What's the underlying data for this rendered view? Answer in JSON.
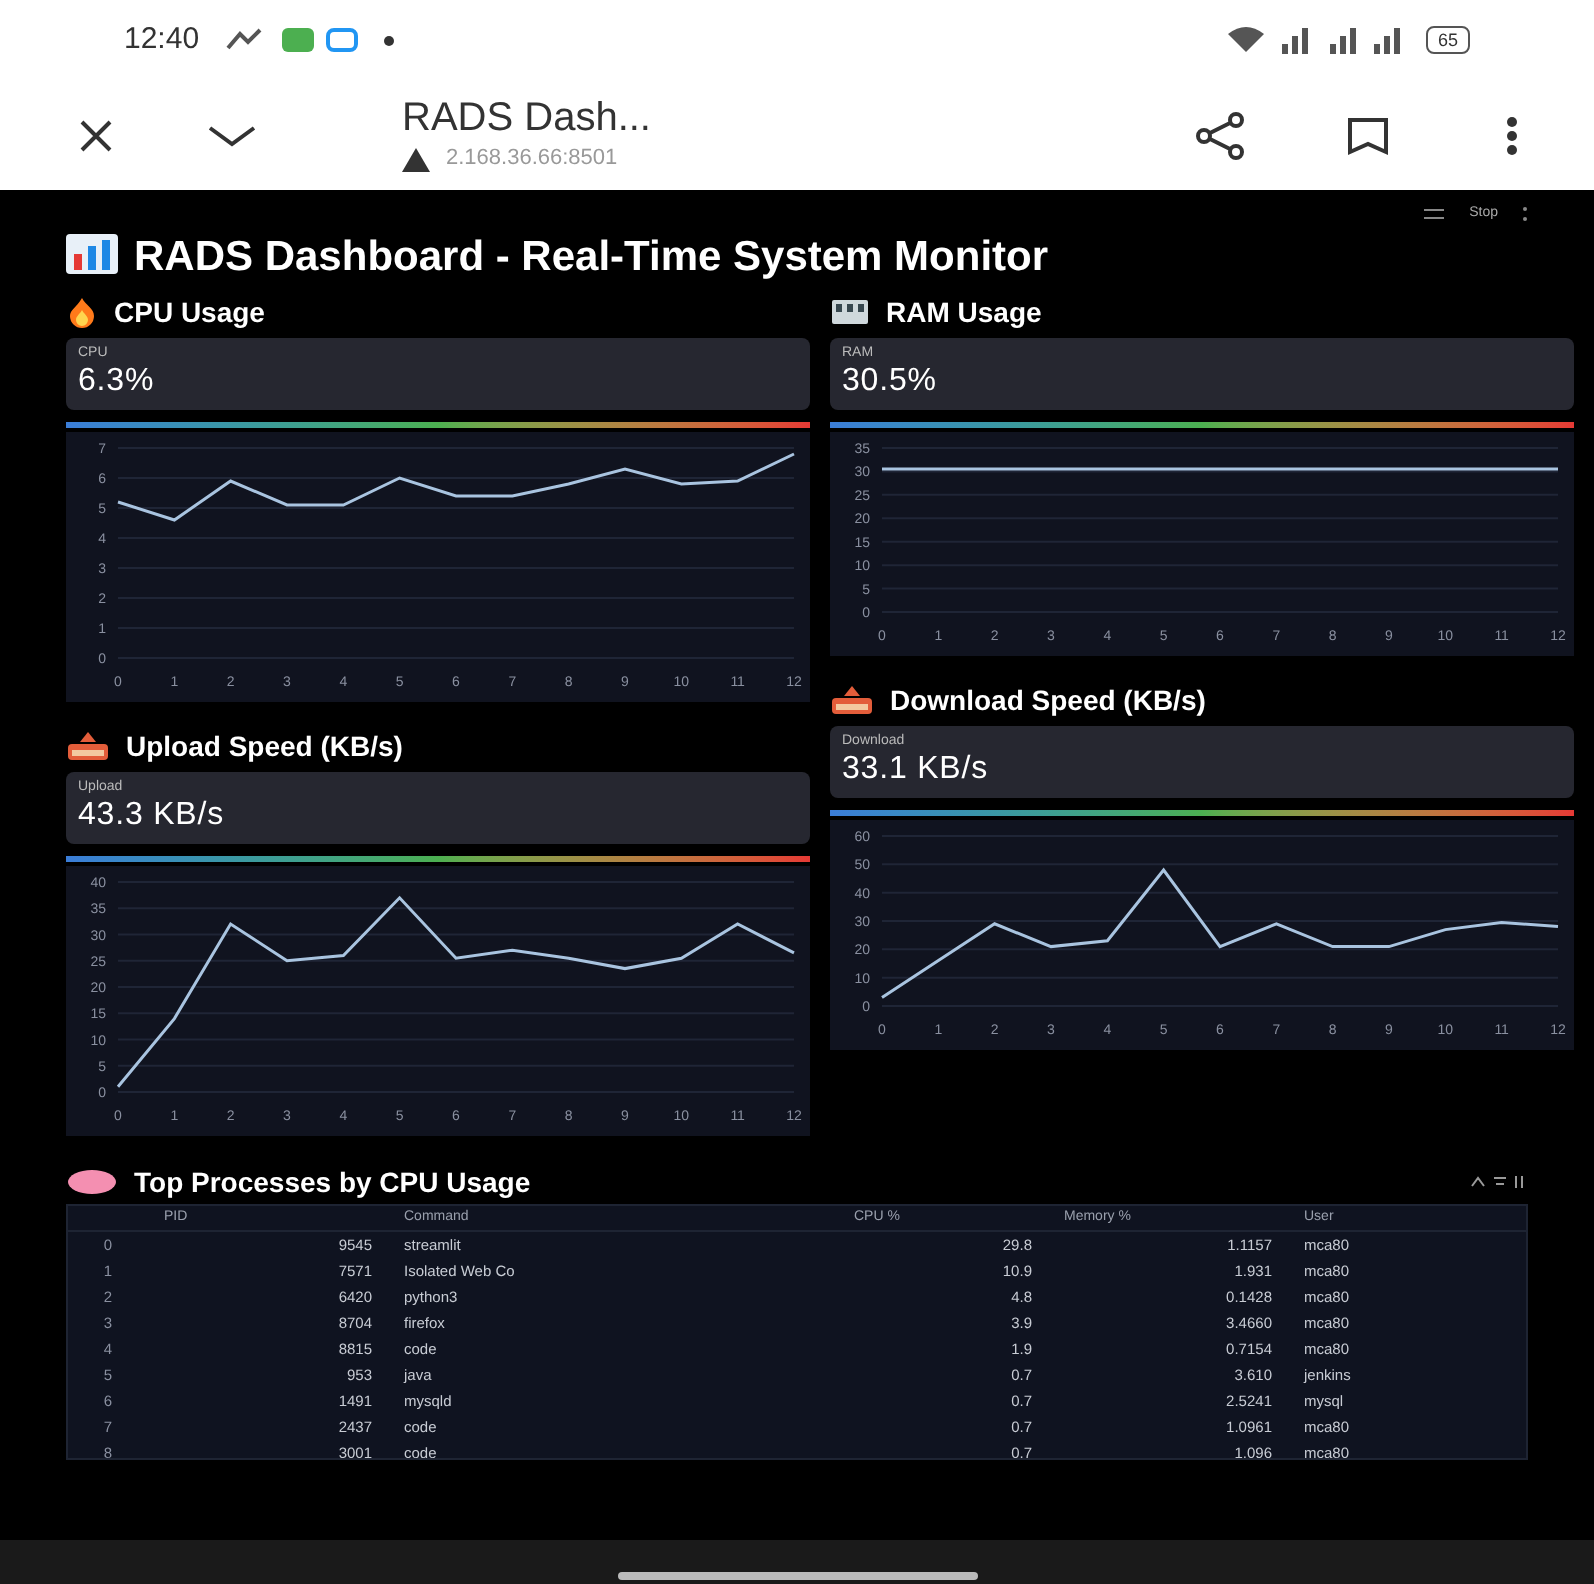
{
  "status_bar": {
    "time": "12:40",
    "battery": "65"
  },
  "browser": {
    "title": "RADS Dash...",
    "url": "2.168.36.66:8501"
  },
  "app_toolbar": {
    "label": "Stop"
  },
  "title": "RADS Dashboard - Real-Time System Monitor",
  "columns": [
    [
      {
        "kind": "flame",
        "header": "CPU Usage",
        "metric_label": "CPU",
        "metric_value": "6.3%",
        "chart_data": {
          "type": "line",
          "grid": true,
          "x": [
            0,
            1,
            2,
            3,
            4,
            5,
            6,
            7,
            8,
            9,
            10,
            11,
            12
          ],
          "xlim": [
            0,
            12
          ],
          "xticks": [
            0,
            1,
            2,
            3,
            4,
            5,
            6,
            7,
            8,
            9,
            10,
            11,
            12
          ],
          "yticks": [
            0,
            1,
            2,
            3,
            4,
            5,
            6,
            7
          ],
          "ylim": [
            0,
            7
          ],
          "series": [
            {
              "color": "#a9c4e0",
              "values": [
                5.2,
                4.6,
                5.9,
                5.1,
                5.1,
                6.0,
                5.4,
                5.4,
                5.8,
                6.3,
                5.8,
                5.9,
                6.8
              ]
            }
          ]
        }
      },
      {
        "kind": "tray",
        "header": "Upload Speed (KB/s)",
        "metric_label": "Upload",
        "metric_value": "43.3 KB/s",
        "chart_data": {
          "type": "line",
          "grid": true,
          "x": [
            0,
            1,
            2,
            3,
            4,
            5,
            6,
            7,
            8,
            9,
            10,
            11,
            12
          ],
          "xlim": [
            0,
            12
          ],
          "xticks": [
            0,
            1,
            2,
            3,
            4,
            5,
            6,
            7,
            8,
            9,
            10,
            11,
            12
          ],
          "yticks": [
            0,
            5,
            10,
            15,
            20,
            25,
            30,
            35,
            40
          ],
          "ylim": [
            0,
            40
          ],
          "series": [
            {
              "color": "#a9c4e0",
              "values": [
                1,
                14,
                32,
                25,
                26,
                37,
                25.5,
                27,
                25.5,
                23.5,
                25.5,
                32,
                26.5
              ]
            }
          ]
        }
      }
    ],
    [
      {
        "kind": "memory",
        "header": "RAM Usage",
        "metric_label": "RAM",
        "metric_value": "30.5%",
        "chart_data": {
          "type": "line",
          "grid": true,
          "x": [
            0,
            1,
            2,
            3,
            4,
            5,
            6,
            7,
            8,
            9,
            10,
            11,
            12
          ],
          "xlim": [
            0,
            12
          ],
          "xticks": [
            0,
            1,
            2,
            3,
            4,
            5,
            6,
            7,
            8,
            9,
            10,
            11,
            12
          ],
          "yticks": [
            0,
            5,
            10,
            15,
            20,
            25,
            30,
            35
          ],
          "ylim": [
            0,
            35
          ],
          "series": [
            {
              "color": "#a9c4e0",
              "values": [
                30.5,
                30.5,
                30.5,
                30.5,
                30.5,
                30.5,
                30.5,
                30.5,
                30.5,
                30.5,
                30.5,
                30.5,
                30.5
              ]
            }
          ]
        }
      },
      {
        "kind": "tray",
        "header": "Download Speed (KB/s)",
        "metric_label": "Download",
        "metric_value": "33.1 KB/s",
        "chart_data": {
          "type": "line",
          "grid": true,
          "x": [
            0,
            1,
            2,
            3,
            4,
            5,
            6,
            7,
            8,
            9,
            10,
            11,
            12
          ],
          "xlim": [
            0,
            12
          ],
          "xticks": [
            0,
            1,
            2,
            3,
            4,
            5,
            6,
            7,
            8,
            9,
            10,
            11,
            12
          ],
          "yticks": [
            0,
            10,
            20,
            30,
            40,
            50,
            60
          ],
          "ylim": [
            0,
            60
          ],
          "series": [
            {
              "color": "#a9c4e0",
              "values": [
                3,
                16,
                29,
                21,
                23,
                48,
                21,
                29,
                21,
                21,
                27,
                29.5,
                28
              ]
            }
          ]
        }
      }
    ]
  ],
  "table_section": {
    "header": "Top Processes by CPU Usage",
    "columns": [
      "PID",
      "Command",
      "CPU %",
      "Memory %",
      "User"
    ],
    "rows": [
      {
        "index": "0",
        "cells": [
          "9545",
          "streamlit",
          "29.8",
          "1.1157",
          "mca80"
        ]
      },
      {
        "index": "1",
        "cells": [
          "7571",
          "Isolated Web Co",
          "10.9",
          "1.931",
          "mca80"
        ]
      },
      {
        "index": "2",
        "cells": [
          "6420",
          "python3",
          "4.8",
          "0.1428",
          "mca80"
        ]
      },
      {
        "index": "3",
        "cells": [
          "8704",
          "firefox",
          "3.9",
          "3.4660",
          "mca80"
        ]
      },
      {
        "index": "4",
        "cells": [
          "8815",
          "code",
          "1.9",
          "0.7154",
          "mca80"
        ]
      },
      {
        "index": "5",
        "cells": [
          "953",
          "java",
          "0.7",
          "3.610",
          "jenkins"
        ]
      },
      {
        "index": "6",
        "cells": [
          "1491",
          "mysqld",
          "0.7",
          "2.5241",
          "mysql"
        ]
      },
      {
        "index": "7",
        "cells": [
          "2437",
          "code",
          "0.7",
          "1.0961",
          "mca80"
        ]
      },
      {
        "index": "8",
        "cells": [
          "3001",
          "code",
          "0.7",
          "1.096",
          "mca80"
        ]
      }
    ]
  }
}
